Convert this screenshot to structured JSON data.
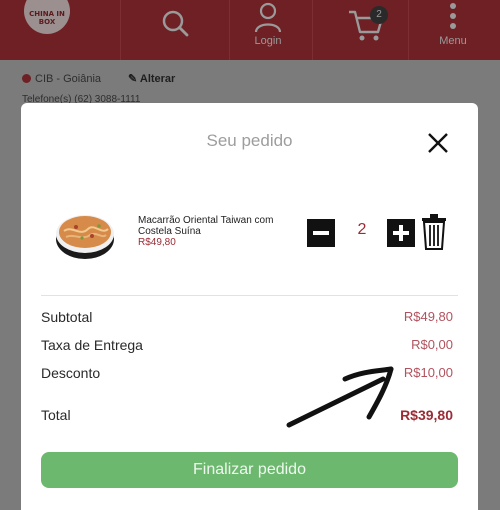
{
  "header": {
    "logo_text": "CHINA IN BOX",
    "nav": [
      {
        "label": "",
        "icon": "search-icon"
      },
      {
        "label": "Login",
        "icon": "user-icon"
      },
      {
        "label": "",
        "icon": "cart-icon",
        "badge": "2"
      },
      {
        "label": "Menu",
        "icon": "kebab-menu-icon"
      }
    ]
  },
  "store": {
    "name": "CIB - Goiânia",
    "change_label": "Alterar",
    "phone": "Telefone(s) (62) 3088-1111"
  },
  "modal": {
    "title": "Seu pedido",
    "item": {
      "name": "Macarrão Oriental Taiwan com Costela Suína",
      "price": "R$49,80",
      "quantity": "2"
    },
    "summary": [
      {
        "label": "Subtotal",
        "value": "R$49,80"
      },
      {
        "label": "Taxa de Entrega",
        "value": "R$0,00"
      },
      {
        "label": "Desconto",
        "value": "R$10,00"
      }
    ],
    "total": {
      "label": "Total",
      "value": "R$39,80"
    },
    "checkout_label": "Finalizar pedido"
  },
  "colors": {
    "brand": "#6e2024",
    "price": "#9b2b35",
    "button": "#6db86f"
  }
}
